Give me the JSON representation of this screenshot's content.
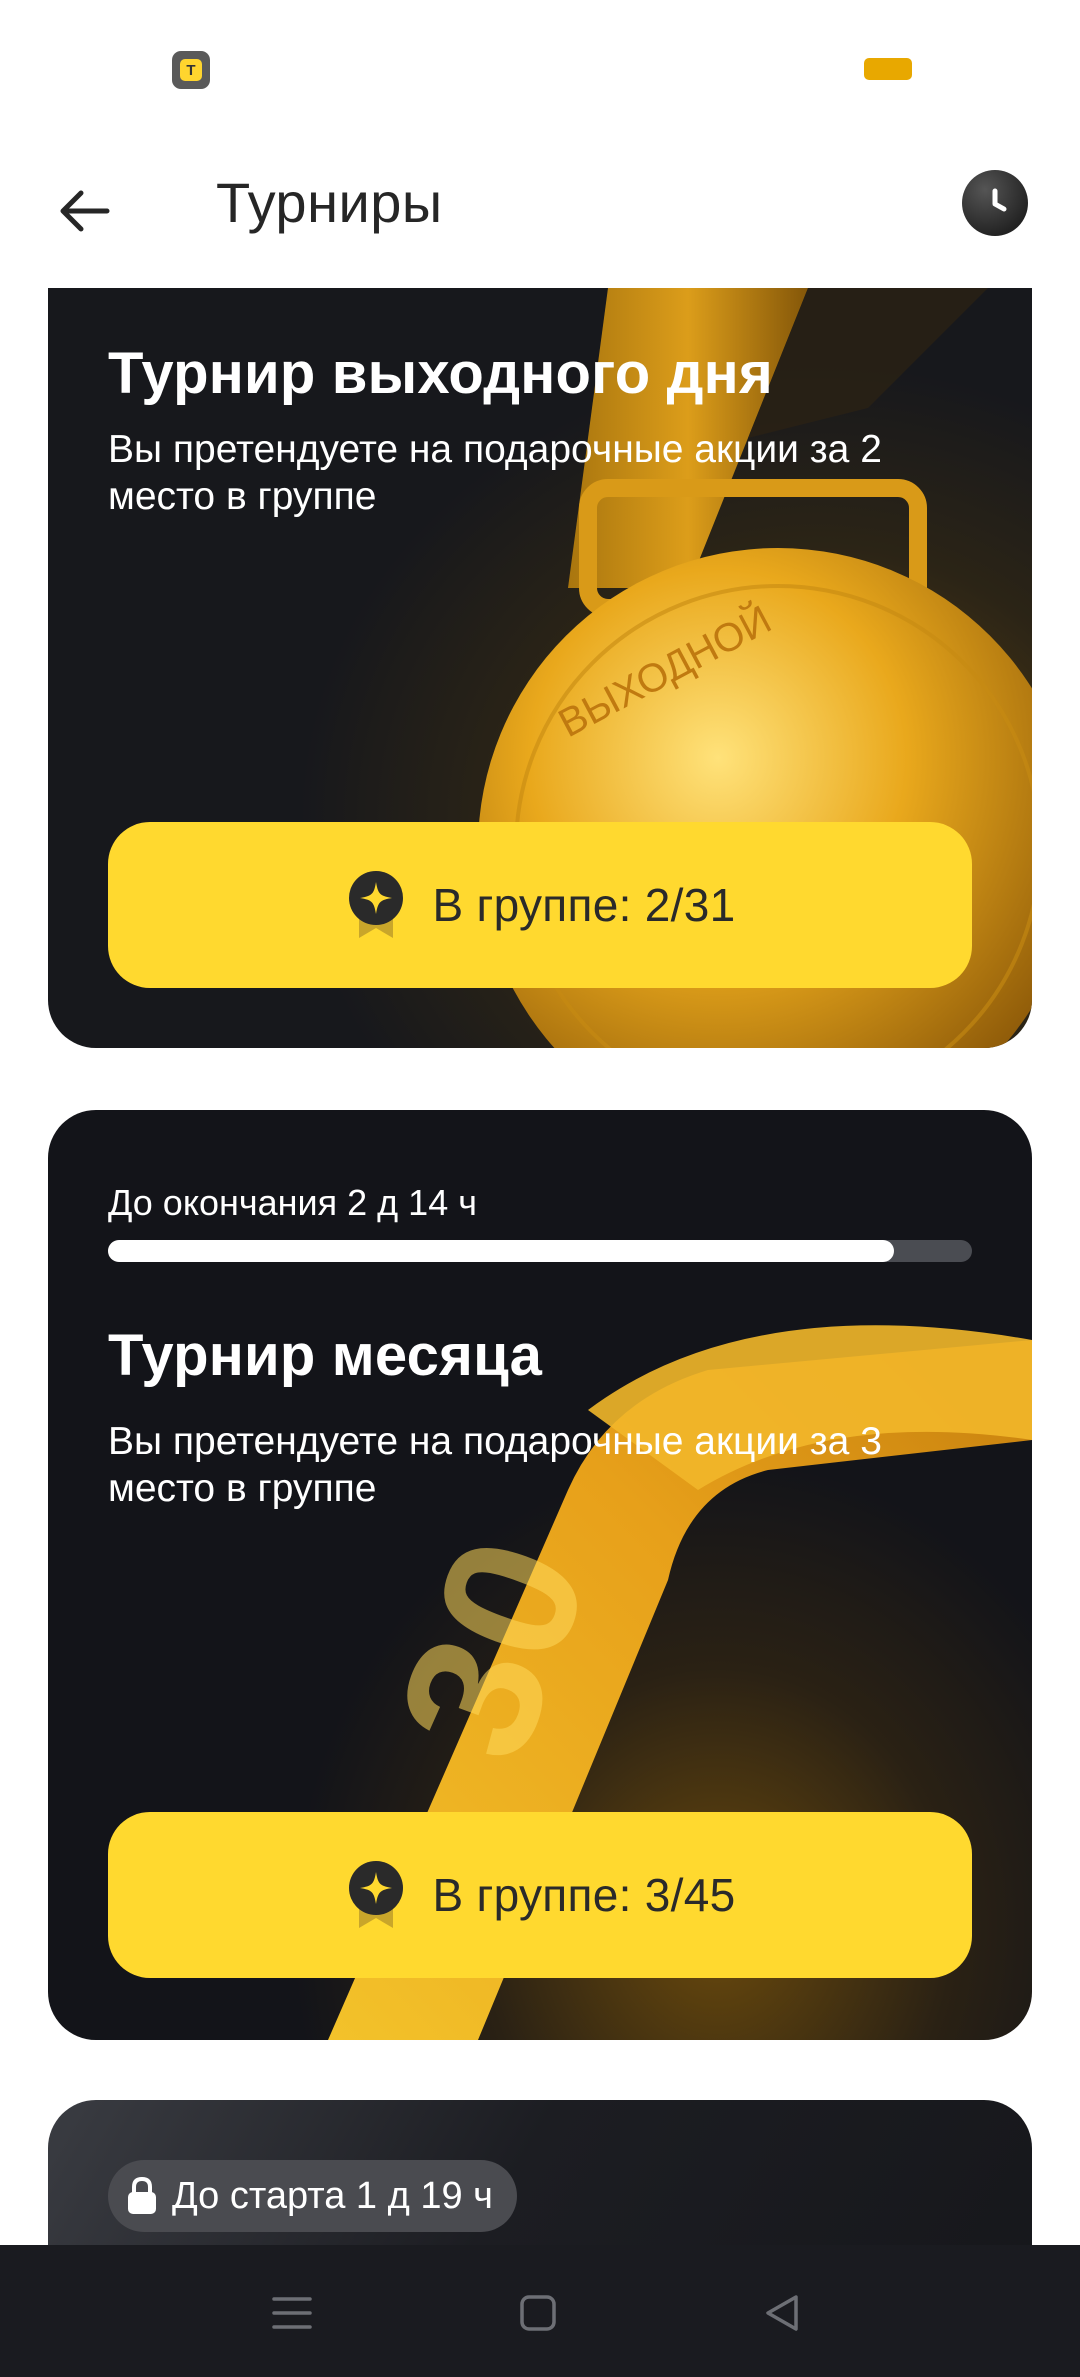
{
  "header": {
    "title": "Турниры"
  },
  "cards": [
    {
      "title": "Турнир выходного дня",
      "description": "Вы претендуете на подарочные акции за 2 место в группе",
      "group_label": "В группе: 2/31",
      "medal_text": "ВЫХОДНОЙ"
    },
    {
      "countdown": "До окончания 2 д 14 ч",
      "progress": 0.91,
      "title": "Турнир месяца",
      "description": "Вы претендуете на подарочные акции за 3 место в группе",
      "group_label": "В группе: 3/45",
      "ribbon_text": "30"
    },
    {
      "start_label": "До старта 1 д 19 ч"
    }
  ],
  "colors": {
    "accent": "#ffd92f",
    "card_bg": "#14161b",
    "nav_bg": "#1a1b20"
  },
  "icons": {
    "back": "arrow-left-icon",
    "history": "clock-icon",
    "badge": "star-medal-icon",
    "lock": "lock-icon",
    "nav": [
      "menu-icon",
      "home-square-icon",
      "back-triangle-icon"
    ]
  }
}
